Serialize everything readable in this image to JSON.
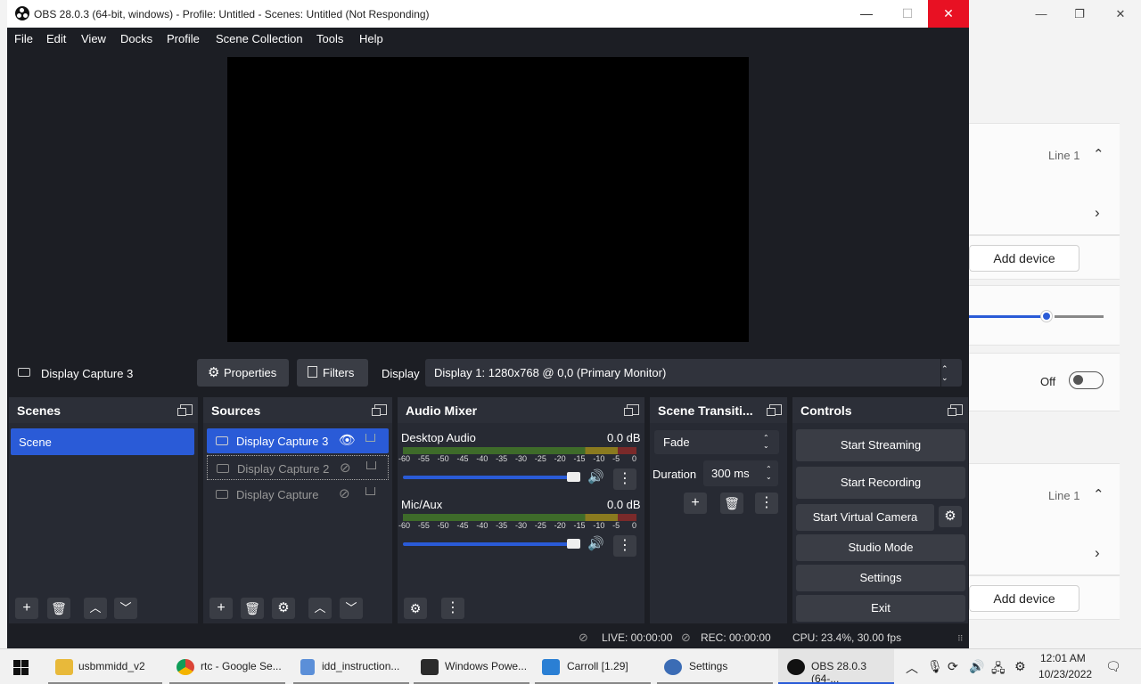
{
  "window": {
    "title": "OBS 28.0.3 (64-bit, windows) - Profile: Untitled - Scenes: Untitled (Not Responding)",
    "minimize": "—",
    "maximize": "☐",
    "close": "✕"
  },
  "menu": [
    "File",
    "Edit",
    "View",
    "Docks",
    "Profile",
    "Scene Collection",
    "Tools",
    "Help"
  ],
  "source_toolbar": {
    "selected": "Display Capture 3",
    "properties": "Properties",
    "filters": "Filters",
    "display_label": "Display",
    "display_value": "Display 1: 1280x768 @ 0,0 (Primary Monitor)"
  },
  "scenes": {
    "title": "Scenes",
    "items": [
      "Scene"
    ]
  },
  "sources": {
    "title": "Sources",
    "items": [
      "Display Capture 3",
      "Display Capture 2",
      "Display Capture"
    ]
  },
  "audio_mixer": {
    "title": "Audio Mixer",
    "channels": [
      {
        "name": "Desktop Audio",
        "db": "0.0 dB",
        "volume": 1.0
      },
      {
        "name": "Mic/Aux",
        "db": "0.0 dB",
        "volume": 1.0
      }
    ],
    "ticks": [
      "-60",
      "-55",
      "-50",
      "-45",
      "-40",
      "-35",
      "-30",
      "-25",
      "-20",
      "-15",
      "-10",
      "-5",
      "0"
    ]
  },
  "transitions": {
    "title": "Scene Transiti...",
    "selected": "Fade",
    "duration_label": "Duration",
    "duration": "300 ms"
  },
  "controls": {
    "title": "Controls",
    "start_streaming": "Start Streaming",
    "start_recording": "Start Recording",
    "start_virtual_camera": "Start Virtual Camera",
    "studio_mode": "Studio Mode",
    "settings": "Settings",
    "exit": "Exit"
  },
  "status": {
    "live": "LIVE: 00:00:00",
    "rec": "REC: 00:00:00",
    "cpu": "CPU: 23.4%, 30.00 fps"
  },
  "bg_settings": {
    "line1_a": "Line 1",
    "add_device_a": "Add device",
    "toggle_off": "Off",
    "line1_b": "Line 1",
    "add_device_b": "Add device"
  },
  "taskbar": {
    "items": [
      "usbmmidd_v2",
      "rtc - Google Se...",
      "idd_instruction...",
      "Windows Powe...",
      "Carroll [1.29]",
      "Settings",
      "OBS 28.0.3 (64-..."
    ],
    "time": "12:01 AM",
    "date": "10/23/2022"
  },
  "colors": {
    "accent": "#2a5bd7",
    "obs_bg": "#1c1e24",
    "dock_bg": "#272a33",
    "button": "#3a3d45"
  }
}
